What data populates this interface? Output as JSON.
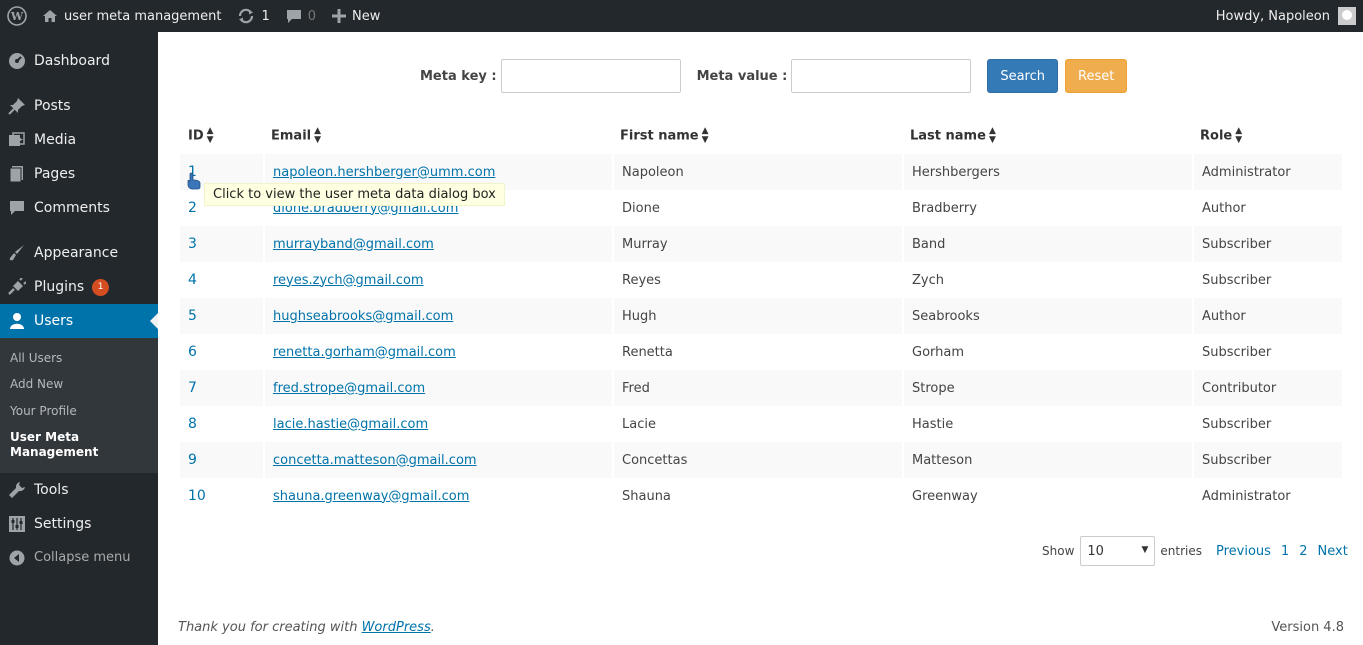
{
  "adminbar": {
    "site_name": "user meta management",
    "updates_count": "1",
    "comments_count": "0",
    "new_label": "New",
    "howdy": "Howdy, Napoleon"
  },
  "sidebar": {
    "items": [
      {
        "label": "Dashboard",
        "icon": "dashboard-icon"
      },
      {
        "label": "Posts",
        "icon": "pin-icon"
      },
      {
        "label": "Media",
        "icon": "media-icon"
      },
      {
        "label": "Pages",
        "icon": "pages-icon"
      },
      {
        "label": "Comments",
        "icon": "comment-icon"
      },
      {
        "label": "Appearance",
        "icon": "brush-icon"
      },
      {
        "label": "Plugins",
        "icon": "plug-icon",
        "badge": "1"
      },
      {
        "label": "Users",
        "icon": "user-icon"
      },
      {
        "label": "Tools",
        "icon": "wrench-icon"
      },
      {
        "label": "Settings",
        "icon": "sliders-icon"
      },
      {
        "label": "Collapse menu",
        "icon": "collapse-icon"
      }
    ],
    "users_submenu": [
      "All Users",
      "Add New",
      "Your Profile",
      "User Meta Management"
    ]
  },
  "search": {
    "meta_key_label": "Meta key :",
    "meta_value_label": "Meta value :",
    "meta_key_value": "",
    "meta_value_value": "",
    "search_button": "Search",
    "reset_button": "Reset"
  },
  "table": {
    "headers": [
      "ID",
      "Email",
      "First name",
      "Last name",
      "Role"
    ],
    "rows": [
      [
        "1",
        "napoleon.hershberger@umm.com",
        "Napoleon",
        "Hershbergers",
        "Administrator"
      ],
      [
        "2",
        "dione.bradberry@gmail.com",
        "Dione",
        "Bradberry",
        "Author"
      ],
      [
        "3",
        "murrayband@gmail.com",
        "Murray",
        "Band",
        "Subscriber"
      ],
      [
        "4",
        "reyes.zych@gmail.com",
        "Reyes",
        "Zych",
        "Subscriber"
      ],
      [
        "5",
        "hughseabrooks@gmail.com",
        "Hugh",
        "Seabrooks",
        "Author"
      ],
      [
        "6",
        "renetta.gorham@gmail.com",
        "Renetta",
        "Gorham",
        "Subscriber"
      ],
      [
        "7",
        "fred.strope@gmail.com",
        "Fred",
        "Strope",
        "Contributor"
      ],
      [
        "8",
        "lacie.hastie@gmail.com",
        "Lacie",
        "Hastie",
        "Subscriber"
      ],
      [
        "9",
        "concetta.matteson@gmail.com",
        "Concettas",
        "Matteson",
        "Subscriber"
      ],
      [
        "10",
        "shauna.greenway@gmail.com",
        "Shauna",
        "Greenway",
        "Administrator"
      ]
    ]
  },
  "tooltip": "Click to view the user meta data dialog box",
  "pagination": {
    "show_label": "Show",
    "entries_value": "10",
    "entries_label": "entries",
    "previous": "Previous",
    "pages": [
      "1",
      "2"
    ],
    "next": "Next"
  },
  "footer": {
    "thanks_prefix": "Thank you for creating with ",
    "wordpress_link": "WordPress",
    "thanks_suffix": ".",
    "version": "Version 4.8"
  }
}
